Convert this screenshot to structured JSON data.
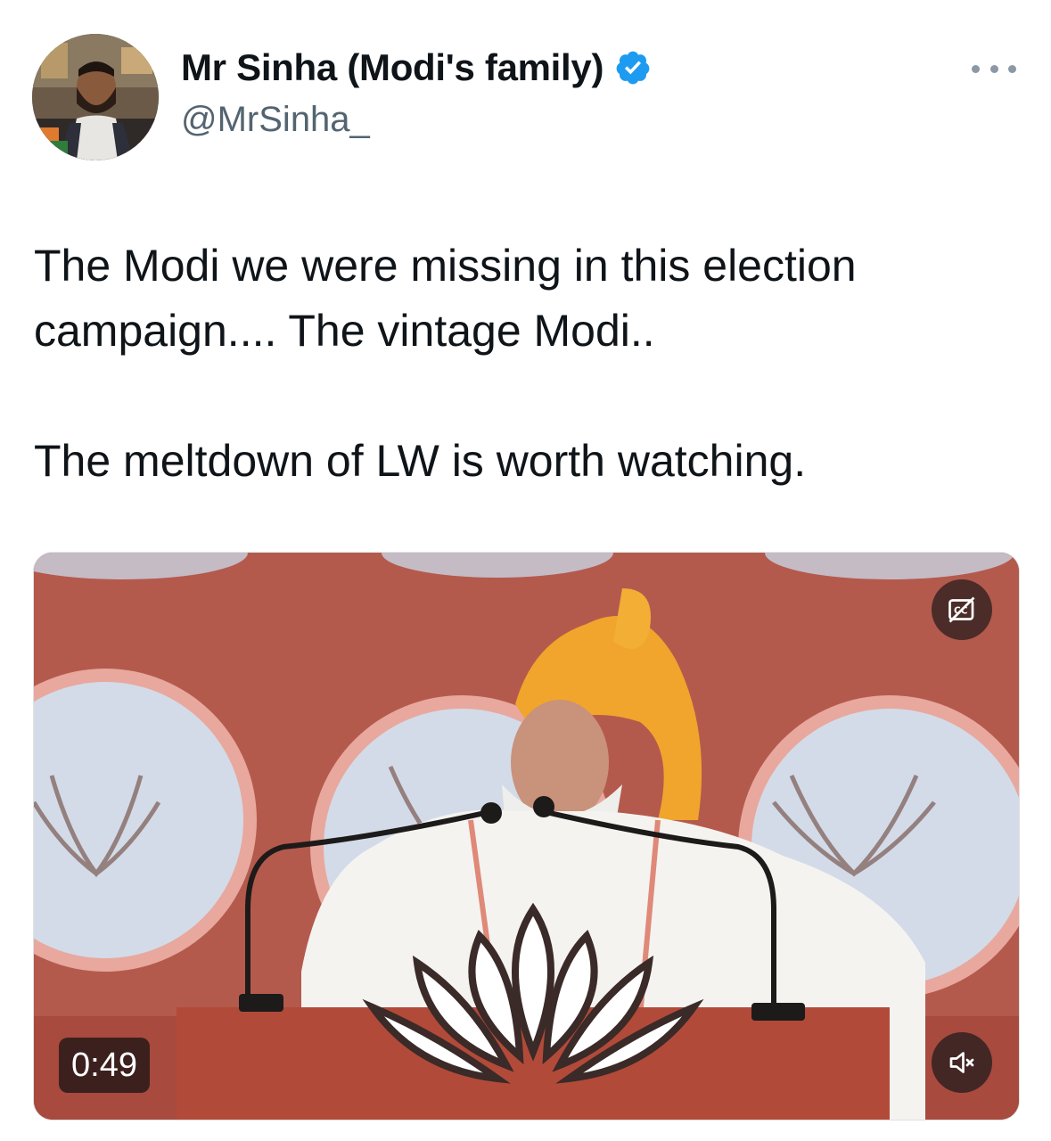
{
  "author": {
    "display_name": "Mr Sinha (Modi's family)",
    "handle": "@MrSinha_",
    "verified": true,
    "avatar_icon": "user-avatar-photo"
  },
  "menu_icon": "more-options-icon",
  "tweet": {
    "lines": [
      "The Modi we were missing in this election campaign.... The vintage Modi..",
      "The meltdown of LW is worth watching."
    ]
  },
  "video": {
    "duration": "0:49",
    "cc_icon": "captions-off-icon",
    "mute_icon": "volume-muted-icon"
  },
  "colors": {
    "verified_blue": "#1d9bf0",
    "text_primary": "#0f1419",
    "text_secondary": "#536471"
  }
}
